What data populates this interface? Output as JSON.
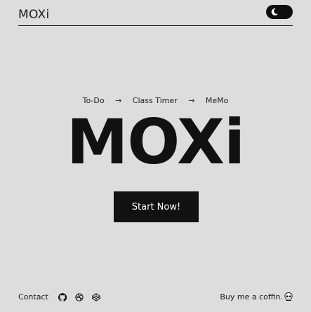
{
  "header": {
    "brand": "MOXi",
    "theme_toggle_icon": "moon-icon"
  },
  "nav": {
    "items": [
      {
        "label": "To-Do"
      },
      {
        "label": "Class Timer"
      },
      {
        "label": "MeMo"
      }
    ],
    "separator": "→"
  },
  "hero": {
    "title": "MOXi"
  },
  "cta": {
    "label": "Start Now!"
  },
  "footer": {
    "contact_label": "Contact",
    "social_icons": [
      "github-icon",
      "dribbble-icon",
      "codepen-icon"
    ],
    "support_label": "Buy me a coffin.",
    "support_icon": "skull-icon"
  },
  "colors": {
    "background": "#dddddd",
    "foreground": "#111111",
    "button": "#111111",
    "button_text": "#ffffff"
  }
}
